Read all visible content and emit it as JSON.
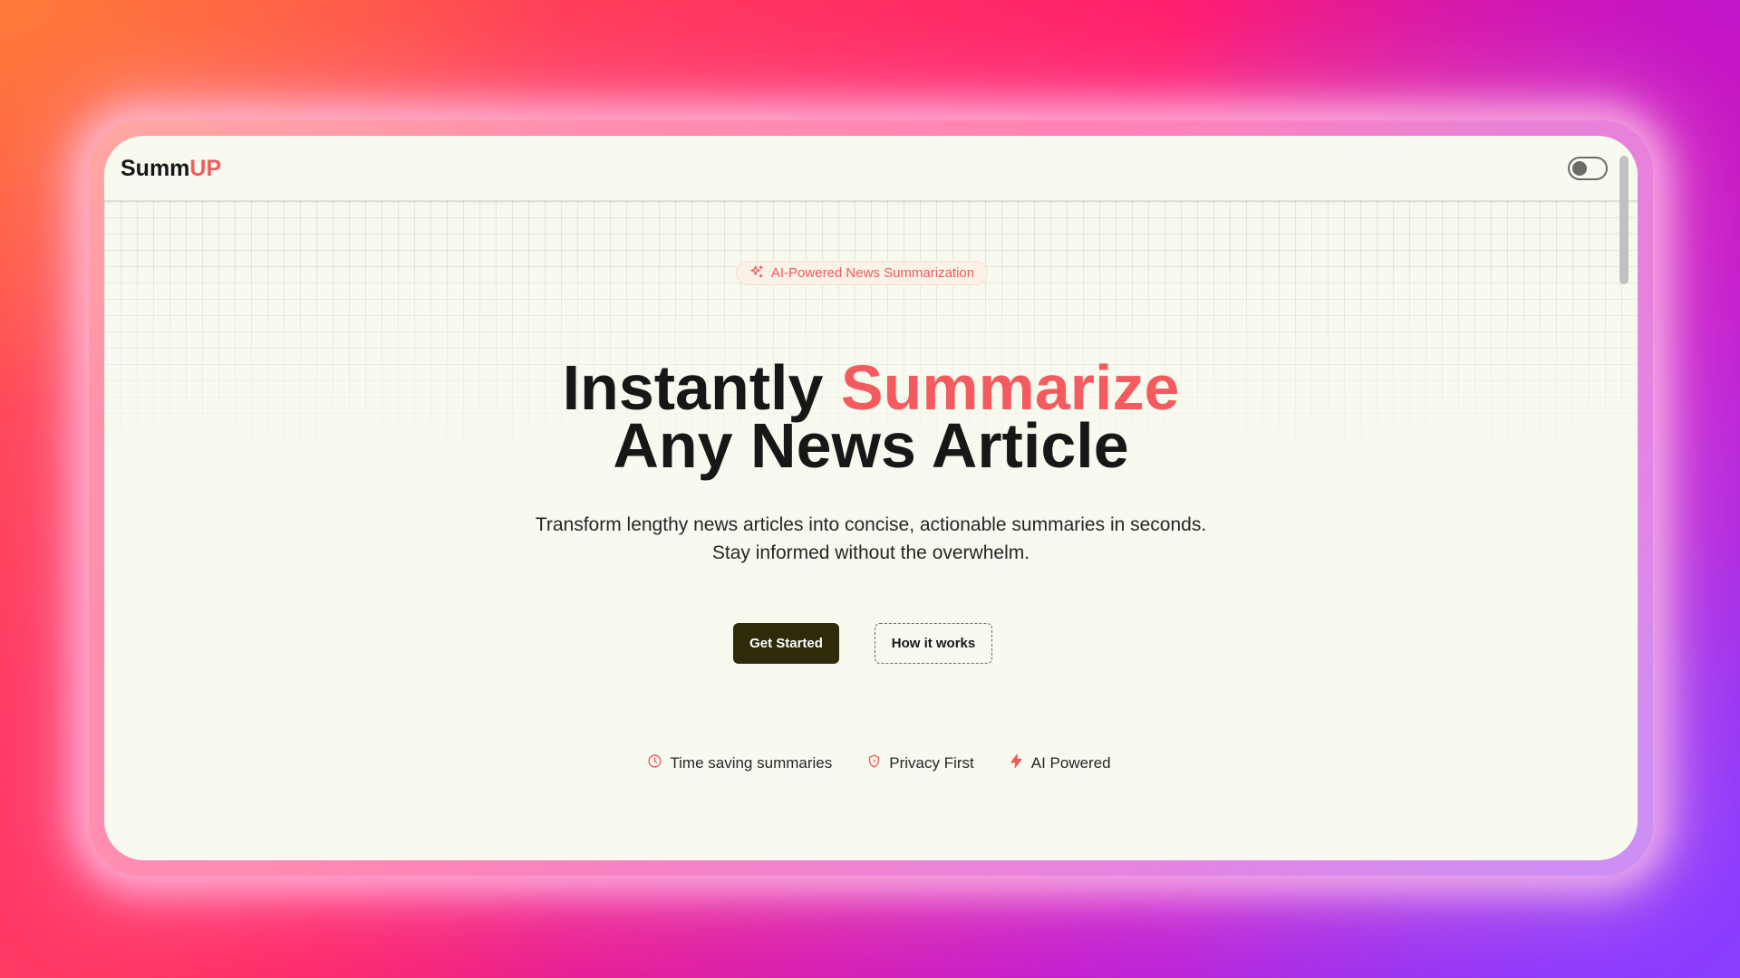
{
  "app": {
    "logo_main": "Summ",
    "logo_accent": "UP"
  },
  "colors": {
    "accent": "#f35b5e",
    "primary_button": "#2f2a09",
    "page_background": "#f8faef"
  },
  "header": {
    "theme_toggle": {
      "state": "off",
      "icon": "theme-toggle"
    }
  },
  "hero": {
    "badge": {
      "icon": "sparkles-icon",
      "text": "AI-Powered News Summarization"
    },
    "headline": {
      "line1_prefix": "Instantly ",
      "line1_accent": "Summarize",
      "line2": "Any News Article"
    },
    "subtitle": {
      "line1": "Transform lengthy news articles into concise, actionable summaries in seconds.",
      "line2": "Stay informed without the overwhelm."
    },
    "buttons": {
      "primary": "Get Started",
      "secondary": "How it works"
    },
    "features": [
      {
        "icon": "clock-icon",
        "label": "Time saving summaries"
      },
      {
        "icon": "shield-icon",
        "label": "Privacy First"
      },
      {
        "icon": "lightning-icon",
        "label": "AI Powered"
      }
    ]
  }
}
